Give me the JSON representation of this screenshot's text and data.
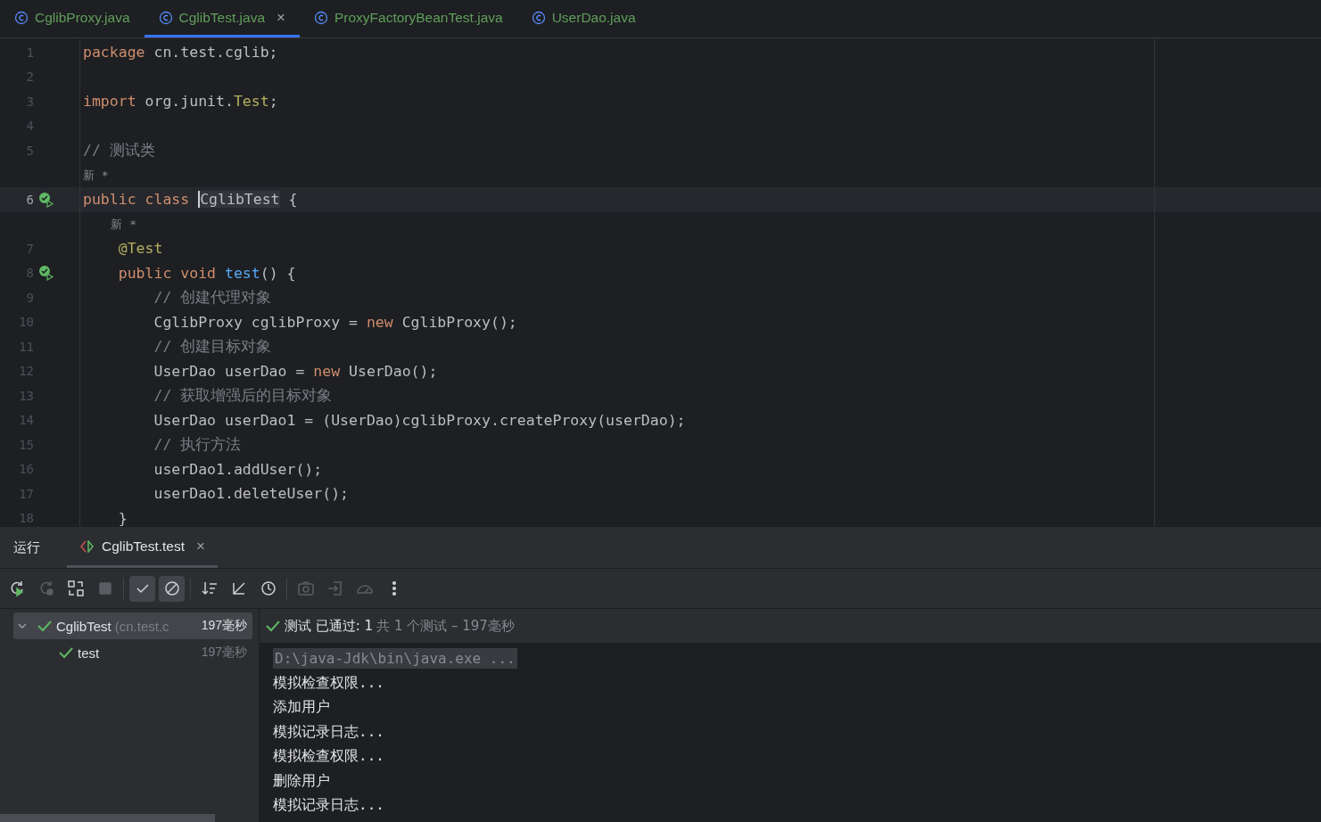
{
  "editor_tabs": [
    {
      "label": "CglibProxy.java",
      "selected": false
    },
    {
      "label": "CglibTest.java",
      "selected": true,
      "close": "×"
    },
    {
      "label": "ProxyFactoryBeanTest.java",
      "selected": false
    },
    {
      "label": "UserDao.java",
      "selected": false
    }
  ],
  "code_lines": [
    {
      "kind": "code",
      "number": "1",
      "run_icon": false,
      "current": false,
      "tokens": [
        {
          "kind": "keyword",
          "text": "package"
        },
        {
          "kind": "plain",
          "text": " cn.test.cglib;"
        }
      ]
    },
    {
      "kind": "code",
      "number": "2",
      "run_icon": false,
      "current": false
    },
    {
      "kind": "code",
      "number": "3",
      "run_icon": false,
      "current": false,
      "tokens": [
        {
          "kind": "keyword",
          "text": "import"
        },
        {
          "kind": "plain",
          "text": " org.junit."
        },
        {
          "kind": "annotation",
          "text": "Test"
        },
        {
          "kind": "plain",
          "text": ";"
        }
      ]
    },
    {
      "kind": "code",
      "number": "4",
      "run_icon": false,
      "current": false
    },
    {
      "kind": "code",
      "number": "5",
      "run_icon": false,
      "current": false,
      "tokens": [
        {
          "kind": "comment",
          "text": "// 测试类"
        }
      ]
    },
    {
      "kind": "hint",
      "text": "新 *"
    },
    {
      "kind": "code",
      "number": "6",
      "run_icon": true,
      "current": true,
      "tokens": [
        {
          "kind": "keyword",
          "text": "public class "
        },
        {
          "kind": "caret-word",
          "text": "CglibTest"
        },
        {
          "kind": "plain",
          "text": " {"
        }
      ]
    },
    {
      "kind": "hint",
      "text": "    新 *"
    },
    {
      "kind": "code",
      "number": "7",
      "run_icon": false,
      "current": false,
      "tokens": [
        {
          "kind": "annotation",
          "text": "    @Test"
        }
      ]
    },
    {
      "kind": "code",
      "number": "8",
      "run_icon": true,
      "current": false,
      "tokens": [
        {
          "kind": "keyword",
          "text": "    public void "
        },
        {
          "kind": "function",
          "text": "test"
        },
        {
          "kind": "plain",
          "text": "() {"
        }
      ]
    },
    {
      "kind": "code",
      "number": "9",
      "run_icon": false,
      "current": false,
      "tokens": [
        {
          "kind": "comment",
          "text": "        // 创建代理对象"
        }
      ]
    },
    {
      "kind": "code",
      "number": "10",
      "run_icon": false,
      "current": false,
      "tokens": [
        {
          "kind": "plain",
          "text": "        CglibProxy cglibProxy = "
        },
        {
          "kind": "keyword",
          "text": "new"
        },
        {
          "kind": "plain",
          "text": " CglibProxy();"
        }
      ]
    },
    {
      "kind": "code",
      "number": "11",
      "run_icon": false,
      "current": false,
      "tokens": [
        {
          "kind": "comment",
          "text": "        // 创建目标对象"
        }
      ]
    },
    {
      "kind": "code",
      "number": "12",
      "run_icon": false,
      "current": false,
      "tokens": [
        {
          "kind": "plain",
          "text": "        UserDao userDao = "
        },
        {
          "kind": "keyword",
          "text": "new"
        },
        {
          "kind": "plain",
          "text": " UserDao();"
        }
      ]
    },
    {
      "kind": "code",
      "number": "13",
      "run_icon": false,
      "current": false,
      "tokens": [
        {
          "kind": "comment",
          "text": "        // 获取增强后的目标对象"
        }
      ]
    },
    {
      "kind": "code",
      "number": "14",
      "run_icon": false,
      "current": false,
      "tokens": [
        {
          "kind": "plain",
          "text": "        UserDao userDao1 = (UserDao)cglibProxy.createProxy(userDao);"
        }
      ]
    },
    {
      "kind": "code",
      "number": "15",
      "run_icon": false,
      "current": false,
      "tokens": [
        {
          "kind": "comment",
          "text": "        // 执行方法"
        }
      ]
    },
    {
      "kind": "code",
      "number": "16",
      "run_icon": false,
      "current": false,
      "tokens": [
        {
          "kind": "plain",
          "text": "        userDao1.addUser();"
        }
      ]
    },
    {
      "kind": "code",
      "number": "17",
      "run_icon": false,
      "current": false,
      "tokens": [
        {
          "kind": "plain",
          "text": "        userDao1.deleteUser();"
        }
      ]
    },
    {
      "kind": "code",
      "number": "18",
      "run_icon": false,
      "current": false,
      "tokens": [
        {
          "kind": "plain",
          "text": "    }"
        }
      ]
    }
  ],
  "run_panel": {
    "title": "运行",
    "tabs": [
      {
        "label": "CglibTest.test",
        "selected": true,
        "close": "×"
      }
    ],
    "toolbar": [
      {
        "kind": "rerun",
        "disabled": false,
        "on": false
      },
      {
        "kind": "rerun-failed",
        "disabled": true,
        "on": false
      },
      {
        "kind": "toggle-auto",
        "disabled": false,
        "on": false
      },
      {
        "kind": "stop",
        "disabled": true,
        "on": false
      },
      {
        "kind": "sep"
      },
      {
        "kind": "show-passed",
        "disabled": false,
        "on": true
      },
      {
        "kind": "show-ignored",
        "disabled": false,
        "on": true
      },
      {
        "kind": "sep"
      },
      {
        "kind": "sort",
        "disabled": false,
        "on": false
      },
      {
        "kind": "import",
        "disabled": false,
        "on": false
      },
      {
        "kind": "history",
        "disabled": false,
        "on": false
      },
      {
        "kind": "sep"
      },
      {
        "kind": "camera",
        "disabled": true,
        "on": false
      },
      {
        "kind": "export",
        "disabled": true,
        "on": false
      },
      {
        "kind": "gauge",
        "disabled": true,
        "on": false
      },
      {
        "kind": "more",
        "disabled": false,
        "on": false
      }
    ],
    "tree": [
      {
        "name": "CglibTest",
        "detail": "(cn.test.c",
        "time": "197毫秒",
        "expanded": true,
        "selected": true,
        "children": [
          {
            "name": "test",
            "time": "197毫秒",
            "selected": false
          }
        ]
      }
    ],
    "status": {
      "passed": "测试 已通过: 1",
      "summary": "共 1 个测试 – 197毫秒"
    },
    "console": [
      {
        "kind": "command",
        "text": "D:\\java-Jdk\\bin\\java.exe ..."
      },
      {
        "kind": "output",
        "text": "模拟检查权限..."
      },
      {
        "kind": "output",
        "text": "添加用户"
      },
      {
        "kind": "output",
        "text": "模拟记录日志..."
      },
      {
        "kind": "output",
        "text": "模拟检查权限..."
      },
      {
        "kind": "output",
        "text": "删除用户"
      },
      {
        "kind": "output",
        "text": "模拟记录日志..."
      }
    ]
  }
}
